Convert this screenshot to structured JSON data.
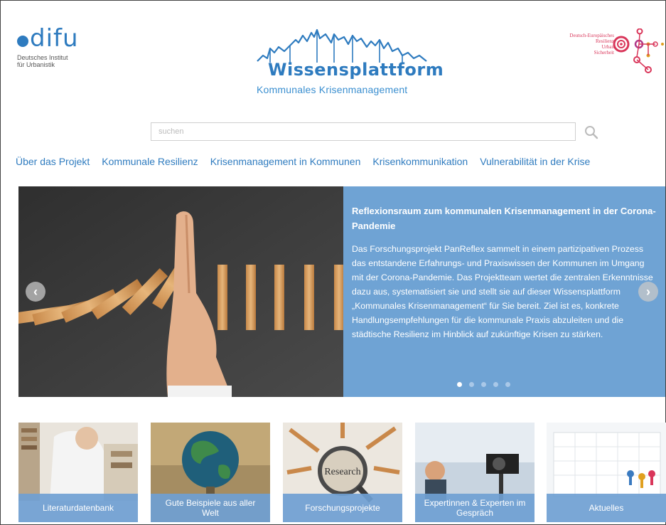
{
  "header": {
    "difu_logo": {
      "word": "difu",
      "subtitle_line1": "Deutsches Institut",
      "subtitle_line2": "für Urbanistik"
    },
    "center_logo": {
      "title": "Wissensplattform",
      "subtitle": "Kommunales Krisenmanagement"
    },
    "right_logo": {
      "line1": "Deutsch-Europäisches",
      "line2": "Resilienz",
      "line3": "Urban",
      "line4": "Sicherheit"
    }
  },
  "search": {
    "placeholder": "suchen"
  },
  "nav": {
    "items": [
      {
        "label": "Über das Projekt"
      },
      {
        "label": "Kommunale Resilienz"
      },
      {
        "label": "Krisenmanagement in Kommunen"
      },
      {
        "label": "Krisenkommunikation"
      },
      {
        "label": "Vulnerabilität in der Krise"
      }
    ]
  },
  "hero": {
    "title": "Reflexionsraum zum kommunalen Krisenmanagement in der Corona-Pandemie",
    "body": "Das Forschungsprojekt PanReflex sammelt in einem partizipativen Prozess das entstandene Erfahrungs- und Praxiswissen der Kommunen im Umgang mit der Corona-Pandemie. Das Projektteam wertet die zentralen Erkenntnisse dazu aus, systematisiert sie und stellt sie auf dieser Wissensplattform „Kommunales Krisenmanagement“ für Sie bereit. Ziel ist es, konkrete Handlungsempfehlungen für die kommunale Praxis abzuleiten und die städtische Resilienz im Hinblick auf zukünftige Krisen zu stärken.",
    "slide_count": 5,
    "active_slide": 1,
    "prev_label": "‹",
    "next_label": "›"
  },
  "tiles": [
    {
      "label": "Literaturdatenbank"
    },
    {
      "label": "Gute Beispiele aus aller Welt"
    },
    {
      "label": "Forschungsprojekte"
    },
    {
      "label": "Expertinnen & Experten im Gespräch"
    },
    {
      "label": "Aktuelles"
    }
  ],
  "tile_images": {
    "research_lens_text": "Research"
  },
  "colors": {
    "brand_blue": "#2e7bbf",
    "hero_blue": "#6fa3d4",
    "accent_pink": "#d9365a"
  }
}
